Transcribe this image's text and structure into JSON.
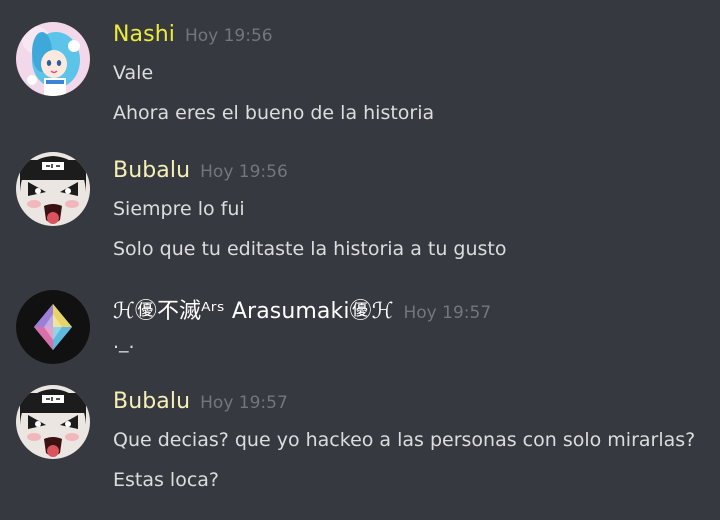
{
  "colors": {
    "background": "#36393f",
    "text": "#dcddde",
    "timestamp": "#72767d",
    "nashi_name": "#ecec3a",
    "bubalu_name": "#f6f0b6",
    "arasumaki_name": "#ffffff"
  },
  "messages": [
    {
      "username": "Nashi",
      "timestamp": "Hoy 19:56",
      "avatar_icon": "anime-girl-avatar-icon",
      "lines": [
        "Vale",
        "Ahora eres el bueno de la historia"
      ]
    },
    {
      "username": "Bubalu",
      "timestamp": "Hoy 19:56",
      "avatar_icon": "cartoon-face-avatar-icon",
      "lines": [
        "Siempre lo fui",
        "Solo que tu editaste la historia a tu gusto"
      ]
    },
    {
      "username": "ℋ㊝不滅ᴬʳˢ Arasumaki㊝ℋ",
      "timestamp": "Hoy 19:57",
      "avatar_icon": "crystal-diamond-avatar-icon",
      "lines": [
        "._."
      ]
    },
    {
      "username": "Bubalu",
      "timestamp": "Hoy 19:57",
      "avatar_icon": "cartoon-face-avatar-icon",
      "lines": [
        "Que decias? que yo hackeo a las personas con solo mirarlas?",
        "Estas loca?"
      ]
    }
  ]
}
